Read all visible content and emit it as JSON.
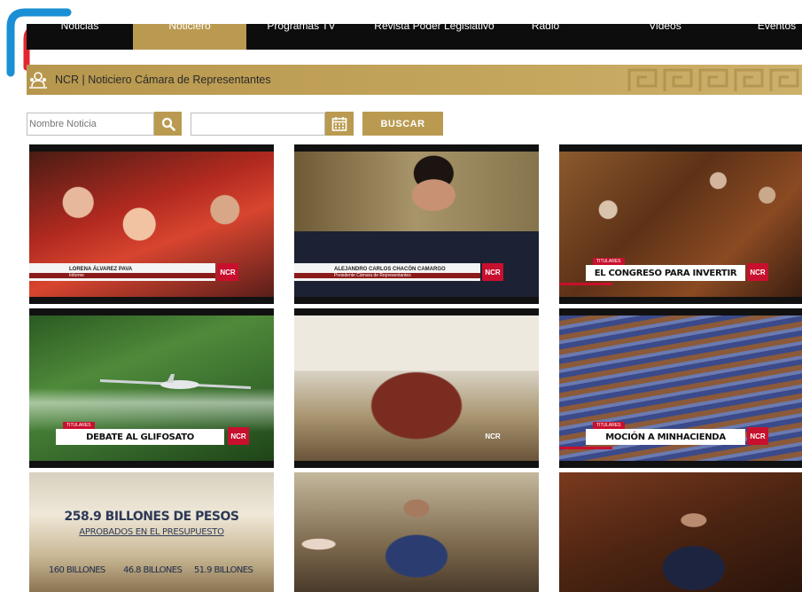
{
  "nav": {
    "items": [
      {
        "label": "Noticias",
        "active": false
      },
      {
        "label": "Noticiero",
        "active": true
      },
      {
        "label": "Programas TV",
        "active": false
      },
      {
        "label": "Revista Poder Legislativo",
        "active": false
      },
      {
        "label": "Radio",
        "active": false
      },
      {
        "label": "Videos",
        "active": false
      },
      {
        "label": "Eventos",
        "active": false
      }
    ]
  },
  "banner": {
    "title": "NCR | Noticiero Cámara de Representantes",
    "icon": "ncr-people-icon"
  },
  "search": {
    "name_placeholder": "Nombre Noticia",
    "button_label": "BUSCAR",
    "search_icon": "search-icon",
    "calendar_icon": "calendar-icon"
  },
  "colors": {
    "accent": "#b99a50",
    "nav_bg": "#0d0d0d",
    "ncr_red": "#c8102e"
  },
  "videos": [
    {
      "lower_name": "LORENA ÁLVAREZ PAVA",
      "lower_role": "Informe",
      "logo": "NCR"
    },
    {
      "lower_name": "ALEJANDRO CARLOS CHACÓN CAMARGO",
      "lower_role": "Presidente Cámara de Representantes",
      "logo": "NCR"
    },
    {
      "tag": "TITULARES",
      "headline": "EL CONGRESO PARA INVERTIR",
      "logo": "NCR"
    },
    {
      "tag": "TITULARES",
      "headline": "DEBATE AL GLIFOSATO",
      "logo": "NCR"
    },
    {
      "logo": "NCR"
    },
    {
      "tag": "TITULARES",
      "headline": "MOCIÓN A MINHACIENDA",
      "logo": "NCR"
    },
    {
      "big_title": "258.9 BILLONES DE PESOS",
      "sub_title": "APROBADOS EN EL PRESUPUESTO",
      "figures": [
        "160 BILLONES",
        "46.8 BILLONES",
        "51.9 BILLONES"
      ]
    },
    {},
    {}
  ]
}
